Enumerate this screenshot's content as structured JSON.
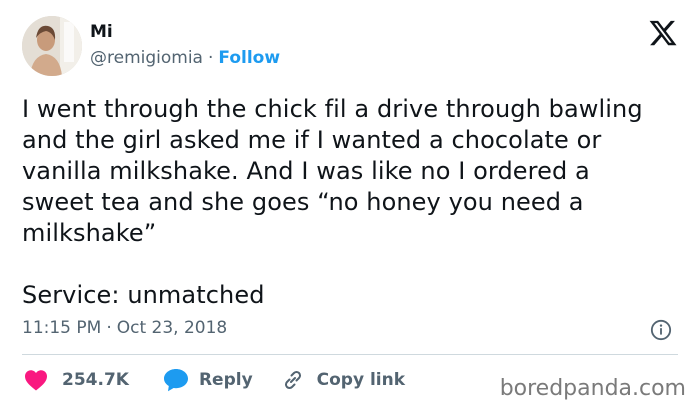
{
  "author": {
    "name": "Mi",
    "handle": "@remigiomia",
    "separator": "·",
    "follow_label": "Follow"
  },
  "tweet": {
    "lines": [
      "I went through the chick fil a drive through bawling",
      "and the girl asked me if I wanted a chocolate or",
      "vanilla milkshake. And I was like no I ordered a",
      "sweet tea and she goes “no honey you need a",
      "milkshake”"
    ],
    "closing_line": "Service: unmatched"
  },
  "meta": {
    "time": "11:15 PM",
    "separator": "·",
    "date": "Oct 23, 2018"
  },
  "actions": {
    "like_count": "254.7K",
    "reply_label": "Reply",
    "copy_label": "Copy link"
  },
  "watermark": "boredpanda.com",
  "colors": {
    "accent": "#1d9bf0",
    "like": "#f91880",
    "muted": "#536471",
    "text": "#0f1419"
  }
}
